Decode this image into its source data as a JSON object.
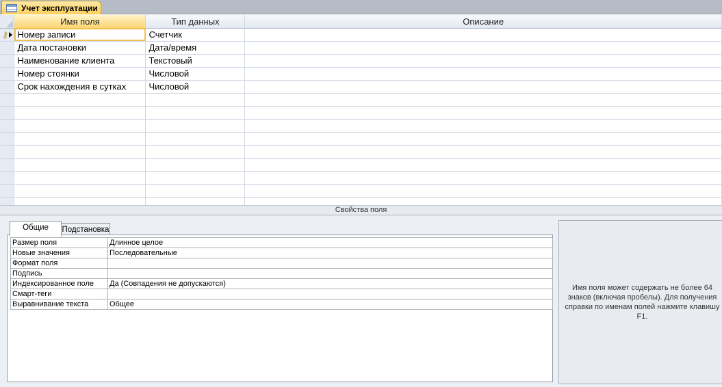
{
  "document": {
    "tab_title": "Учет эксплуатации"
  },
  "grid": {
    "columns": {
      "field_name": "Имя поля",
      "data_type": "Тип данных",
      "description": "Описание"
    },
    "rows": [
      {
        "name": "Номер записи",
        "type": "Счетчик",
        "description": ""
      },
      {
        "name": "Дата постановки",
        "type": "Дата/время",
        "description": ""
      },
      {
        "name": "Наименование клиента",
        "type": "Текстовый",
        "description": ""
      },
      {
        "name": "Номер стоянки",
        "type": "Числовой",
        "description": ""
      },
      {
        "name": "Срок нахождения в сутках",
        "type": "Числовой",
        "description": ""
      },
      {
        "name": "",
        "type": "",
        "description": ""
      },
      {
        "name": "",
        "type": "",
        "description": ""
      },
      {
        "name": "",
        "type": "",
        "description": ""
      },
      {
        "name": "",
        "type": "",
        "description": ""
      },
      {
        "name": "",
        "type": "",
        "description": ""
      },
      {
        "name": "",
        "type": "",
        "description": ""
      },
      {
        "name": "",
        "type": "",
        "description": ""
      },
      {
        "name": "",
        "type": "",
        "description": ""
      },
      {
        "name": "",
        "type": "",
        "description": ""
      }
    ],
    "primary_key_icon": "key-icon",
    "current_row_icon": "row-selector-arrow-icon"
  },
  "properties": {
    "caption": "Свойства поля",
    "tabs": {
      "general": "Общие",
      "lookup": "Подстановка"
    },
    "items": [
      {
        "name": "Размер поля",
        "value": "Длинное целое"
      },
      {
        "name": "Новые значения",
        "value": "Последовательные"
      },
      {
        "name": "Формат поля",
        "value": ""
      },
      {
        "name": "Подпись",
        "value": ""
      },
      {
        "name": "Индексированное поле",
        "value": "Да (Совпадения не допускаются)"
      },
      {
        "name": "Смарт-теги",
        "value": ""
      },
      {
        "name": "Выравнивание текста",
        "value": "Общее"
      }
    ],
    "help_text": "Имя поля может содержать не более 64 знаков (включая пробелы). Для получения справки по именам полей нажмите клавишу F1."
  },
  "colors": {
    "active_tab": "#fccf5b",
    "selection_outline": "#f2c14f",
    "grid_lines": "#d0d7e5"
  }
}
